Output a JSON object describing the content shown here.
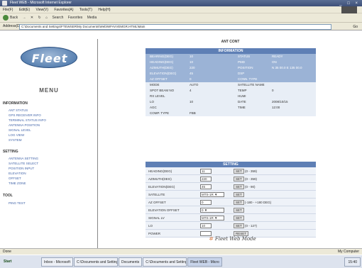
{
  "window": {
    "title": "Fleet WEB - Microsoft Internet Explorer",
    "controls": "_ □ ×"
  },
  "menubar": {
    "items": [
      "File(F)",
      "Edit(E)",
      "View(V)",
      "Favorites(A)",
      "Tools(T)",
      "Help(H)"
    ]
  },
  "toolbar": {
    "back": "Back",
    "items": [
      "Search",
      "Favorites",
      "Media"
    ]
  },
  "address": {
    "label": "Address(D)",
    "value": "C:\\Documents and Settings\\FTEWSER\\My Documents\\Web\\WFAVVEMGR.HTML\\Main",
    "go": "Go"
  },
  "sidebar": {
    "logo": "Fleet",
    "menu_title": "MENU",
    "sections": [
      {
        "title": "INFORMATION",
        "items": [
          "ANT STATUS",
          "GPS RECEIVER INFO",
          "TERMINAL STATUS INFO",
          "ANTENNA POSITION",
          "SIGNAL LEVEL",
          "LOG VIEW",
          "SYSTEM"
        ]
      },
      {
        "title": "SETTING",
        "items": [
          "ANTENNA SETTING",
          "SATELLITE SELECT",
          "POSITION INPUT",
          "ELEVATION",
          "OFFSET",
          "TIME ZONE"
        ]
      },
      {
        "title": "TOOL",
        "items": [
          "PING TEST"
        ]
      }
    ]
  },
  "main": {
    "heading": "ANT CONT",
    "info": {
      "header": "INFORMATION",
      "rows": [
        {
          "l1": "BEARING(DEG)",
          "v1": "10",
          "l2": "STATUS",
          "v2": "READY"
        },
        {
          "l1": "HEADING(DEG)",
          "v1": "10",
          "l2": "PMD",
          "v2": "ON"
        },
        {
          "l1": "AZIMUTH(DEG)",
          "v1": "220",
          "l2": "POSITION",
          "v2": "N 35 00.0  E 135 00.0"
        },
        {
          "l1": "ELEVATION(DEG)",
          "v1": "45",
          "l2": "DSP",
          "v2": ""
        },
        {
          "l1": "AZ OFFSET",
          "v1": "0",
          "l2": "CONN. TYPE",
          "v2": ""
        },
        {
          "l1": "MODE",
          "v1": "AUTO",
          "l2": "SATELLITE NAME",
          "v2": ""
        },
        {
          "l1": "SPOT BEAM NO",
          "v1": "4",
          "l2": "TEMP",
          "v2": "0"
        },
        {
          "l1": "RX LEVEL",
          "v1": "",
          "l2": "HUMI",
          "v2": ""
        },
        {
          "l1": "LO",
          "v1": "10",
          "l2": "DATE",
          "v2": "2008/10/15"
        },
        {
          "l1": "AGC",
          "v1": "",
          "l2": "TIME",
          "v2": "12:00"
        },
        {
          "l1": "COMP. TYPE",
          "v1": "FBB",
          "l2": "",
          "v2": ""
        }
      ]
    },
    "settings": {
      "header": "SETTING",
      "rows": [
        {
          "label": "HEADING(DEG)",
          "input": "11",
          "btn": "SET",
          "note": "(0 - 359)"
        },
        {
          "label": "AZIMUTH(DEG)",
          "input": "220",
          "btn": "SET",
          "note": "(0 - 359)"
        },
        {
          "label": "ELEVATION(DEG)",
          "input": "45",
          "btn": "SET",
          "note": "(0 - 90)"
        },
        {
          "label": "SATELLITE",
          "select": "MTS-1R",
          "btn": "SET",
          "note": ""
        },
        {
          "label": "AZ OFFSET",
          "input": "0",
          "btn": "SET",
          "note": "(-180 - +180 DEG)"
        },
        {
          "label": "ELEVATION OFFSET",
          "select": "0",
          "btn": "SET",
          "note": ""
        },
        {
          "label": "SIGNAL LV",
          "select": "MTS-1R",
          "btn": "SET",
          "note": ""
        },
        {
          "label": "LO",
          "input": "10",
          "btn": "SET",
          "note": "(0 - 127)"
        },
        {
          "label": "POWER",
          "input": "",
          "btn": "RESET",
          "note": ""
        }
      ]
    },
    "footer": "Fleet Web Mode"
  },
  "statusbar": {
    "left": "Done",
    "right": "My Computer"
  },
  "taskbar": {
    "start": "Start",
    "tasks": [
      "Inbox - Microsoft",
      "C:\\Documents and Settings",
      "Documents",
      "C:\\Documents and Settings",
      "Fleet WEB - Micro"
    ],
    "tray": "15:40"
  }
}
